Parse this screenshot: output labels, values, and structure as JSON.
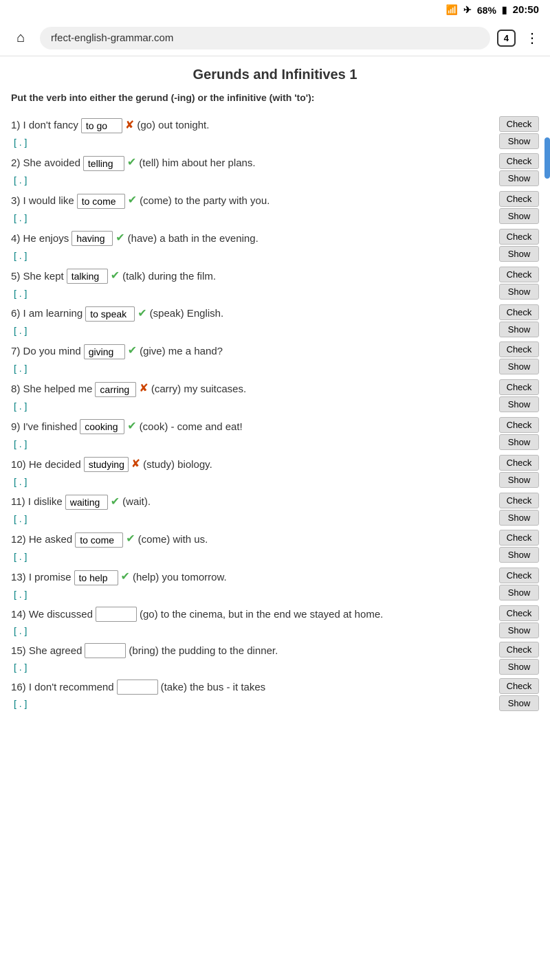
{
  "statusBar": {
    "wifi": "📶",
    "airplane": "✈",
    "battery_pct": "68%",
    "battery_icon": "🔋",
    "time": "20:50"
  },
  "browserBar": {
    "url": "rfect-english-grammar.com",
    "tab_count": "4",
    "home_icon": "⌂",
    "menu_icon": "⋮"
  },
  "page": {
    "title": "Gerunds and Infinitives 1",
    "instructions": "Put the verb into either the gerund (-ing) or the infinitive (with 'to'):",
    "check_label": "Check",
    "show_label": "Show",
    "feedback_text": "[ . ]"
  },
  "questions": [
    {
      "id": 1,
      "prefix": "1) I don't fancy",
      "answer": "to go",
      "status": "wrong",
      "verb": "(go)",
      "suffix": "out tonight.",
      "input_width": "60"
    },
    {
      "id": 2,
      "prefix": "2) She avoided",
      "answer": "telling",
      "status": "correct",
      "verb": "(tell)",
      "suffix": "him about her plans.",
      "input_width": "60"
    },
    {
      "id": 3,
      "prefix": "3) I would like",
      "answer": "to come",
      "status": "correct",
      "verb": "(come)",
      "suffix": "to the party with you.",
      "input_width": "70"
    },
    {
      "id": 4,
      "prefix": "4) He enjoys",
      "answer": "having",
      "status": "correct",
      "verb": "(have)",
      "suffix": "a bath in the evening.",
      "input_width": "60"
    },
    {
      "id": 5,
      "prefix": "5) She kept",
      "answer": "talking",
      "status": "correct",
      "verb": "(talk)",
      "suffix": "during the film.",
      "input_width": "60"
    },
    {
      "id": 6,
      "prefix": "6) I am learning",
      "answer": "to speak",
      "status": "correct",
      "verb": "(speak)",
      "suffix": "English.",
      "input_width": "72"
    },
    {
      "id": 7,
      "prefix": "7) Do you mind",
      "answer": "giving",
      "status": "correct",
      "verb": "(give)",
      "suffix": "me a hand?",
      "input_width": "60"
    },
    {
      "id": 8,
      "prefix": "8) She helped me",
      "answer": "carring",
      "status": "wrong",
      "verb": "(carry)",
      "suffix": "my suitcases.",
      "input_width": "60"
    },
    {
      "id": 9,
      "prefix": "9) I've finished",
      "answer": "cooking",
      "status": "correct",
      "verb": "(cook)",
      "suffix": "- come and eat!",
      "input_width": "65"
    },
    {
      "id": 10,
      "prefix": "10) He decided",
      "answer": "studying",
      "status": "wrong",
      "verb": "(study)",
      "suffix": "biology.",
      "input_width": "65"
    },
    {
      "id": 11,
      "prefix": "11) I dislike",
      "answer": "waiting",
      "status": "correct",
      "verb": "(wait).",
      "suffix": "",
      "input_width": "62"
    },
    {
      "id": 12,
      "prefix": "12) He asked",
      "answer": "to come",
      "status": "correct",
      "verb": "(come)",
      "suffix": "with us.",
      "input_width": "70"
    },
    {
      "id": 13,
      "prefix": "13) I promise",
      "answer": "to help",
      "status": "correct",
      "verb": "(help)",
      "suffix": "you tomorrow.",
      "input_width": "64"
    },
    {
      "id": 14,
      "prefix": "14) We discussed",
      "answer": "",
      "status": "empty",
      "verb": "(go)",
      "suffix": "to the cinema, but in the end we stayed at home.",
      "input_width": "60"
    },
    {
      "id": 15,
      "prefix": "15) She agreed",
      "answer": "",
      "status": "empty",
      "verb": "(bring)",
      "suffix": "the pudding to the dinner.",
      "input_width": "60"
    },
    {
      "id": 16,
      "prefix": "16) I don't recommend",
      "answer": "",
      "status": "empty",
      "verb": "(take)",
      "suffix": "the bus - it takes",
      "input_width": "60"
    }
  ]
}
